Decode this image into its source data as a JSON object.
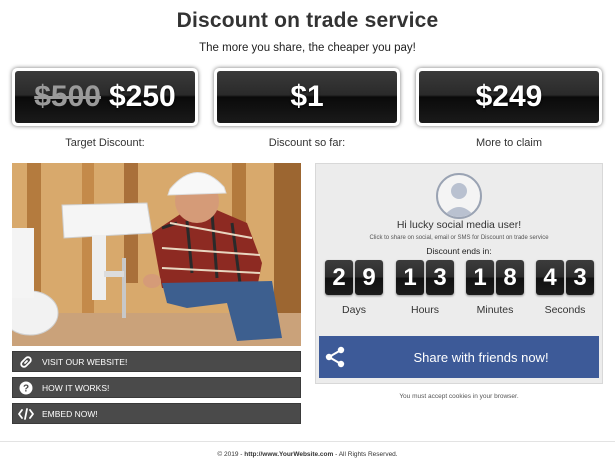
{
  "header": {
    "title": "Discount on trade service",
    "subtitle": "The more you share, the cheaper you pay!"
  },
  "prices": [
    {
      "old": "$500",
      "value": "$250",
      "label": "Target Discount:"
    },
    {
      "value": "$1",
      "label": "Discount so far:"
    },
    {
      "value": "$249",
      "label": "More to claim"
    }
  ],
  "links": [
    {
      "label": "VISIT OUR WEBSITE!",
      "icon": "link-icon"
    },
    {
      "label": "HOW IT WORKS!",
      "icon": "question-icon"
    },
    {
      "label": "EMBED NOW!",
      "icon": "code-icon"
    }
  ],
  "panel": {
    "greeting": "Hi lucky social media user!",
    "hint": "Click to share on social, email or SMS for Discount on trade service",
    "ends_label": "Discount ends in:",
    "countdown": {
      "days": [
        "2",
        "9"
      ],
      "hours": [
        "1",
        "3"
      ],
      "minutes": [
        "1",
        "8"
      ],
      "seconds": [
        "4",
        "3"
      ]
    },
    "units": {
      "days": "Days",
      "hours": "Hours",
      "minutes": "Minutes",
      "seconds": "Seconds"
    }
  },
  "share": {
    "label": "Share with friends now!",
    "color": "#3d5a98",
    "icon": "share-icon"
  },
  "cookie_note": "You must accept cookies in your browser.",
  "footer": {
    "prefix": "© 2019 - ",
    "url": "http://www.YourWebsite.com",
    "suffix": " - All Rights Reserved."
  }
}
